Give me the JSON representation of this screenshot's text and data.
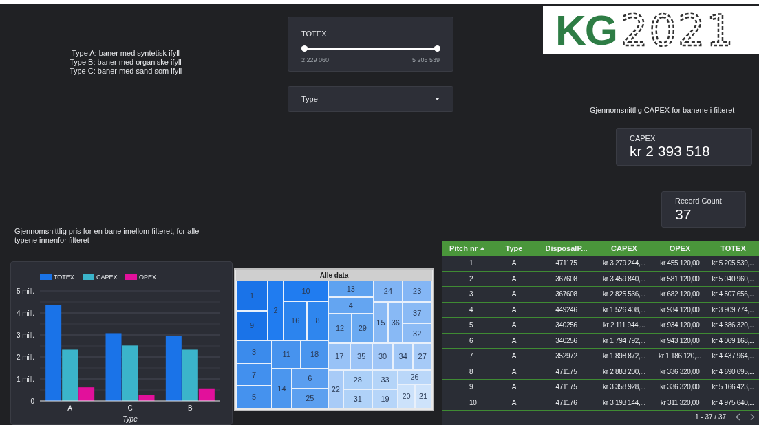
{
  "type_legend": [
    "Type A: baner med syntetisk ifyll",
    "Type B: baner med organiske ifyll",
    "Type C: baner med sand som ifyll"
  ],
  "totex_filter": {
    "label": "TOTEX",
    "min_thumb": {
      "level": 0
    },
    "max_thumb": {
      "level": 1
    },
    "min_value": "2 229 060",
    "max_value": "5 205 539"
  },
  "type_filter": {
    "label": "Type"
  },
  "logo": {
    "bold_text": "KG",
    "outline_text": "2021"
  },
  "capex_caption": "Gjennomsnittlig CAPEX for banene i filteret",
  "capex_scorecard": {
    "label": "CAPEX",
    "value": "kr 2 393 518"
  },
  "record_count": {
    "label": "Record Count",
    "value": "37"
  },
  "bar_chart_caption": "Gjennomsnittlig pris for en bane imellom filteret, for alle typene innenfor filteret",
  "bar_chart": {
    "chart_data": {
      "type": "bar",
      "xlabel": "Type",
      "categories": [
        "A",
        "C",
        "B"
      ],
      "series": [
        {
          "name": "TOTEX",
          "color": "#1a73e8",
          "values": [
            4.37,
            3.08,
            2.96
          ]
        },
        {
          "name": "CAPEX",
          "color": "#3bb4ca",
          "values": [
            2.33,
            2.52,
            2.33
          ]
        },
        {
          "name": "OPEX",
          "color": "#e2109b",
          "values": [
            0.62,
            0.27,
            0.57
          ]
        }
      ],
      "ylim": [
        0,
        5
      ],
      "grid": true,
      "legend": "top",
      "yticks": [
        {
          "value": 0,
          "label": "0"
        },
        {
          "value": 1,
          "label": "1 mill."
        },
        {
          "value": 2,
          "label": "2 mill."
        },
        {
          "value": 3,
          "label": "3 mill."
        },
        {
          "value": 4,
          "label": "4 mill."
        },
        {
          "value": 5,
          "label": "5 mill."
        }
      ]
    }
  },
  "treemap": {
    "title": "Alle data",
    "cells": [
      {
        "label": "1",
        "color": "#1a73e8"
      },
      {
        "label": "9",
        "color": "#1a73e8"
      },
      {
        "label": "2",
        "color": "#207cf0"
      },
      {
        "label": "10",
        "color": "#207cf0"
      },
      {
        "label": "16",
        "color": "#2c84ee"
      },
      {
        "label": "8",
        "color": "#2f86ee"
      },
      {
        "label": "13",
        "color": "#5ea2f0"
      },
      {
        "label": "4",
        "color": "#64a5f1"
      },
      {
        "label": "12",
        "color": "#68a8f1"
      },
      {
        "label": "29",
        "color": "#6aaaf2"
      },
      {
        "label": "24",
        "color": "#80b4f4"
      },
      {
        "label": "23",
        "color": "#84b6f5"
      },
      {
        "label": "15",
        "color": "#88b9f5"
      },
      {
        "label": "36",
        "color": "#88b9f5"
      },
      {
        "label": "37",
        "color": "#8abaf5"
      },
      {
        "label": "32",
        "color": "#8cbbf5"
      },
      {
        "label": "3",
        "color": "#3b8bec"
      },
      {
        "label": "7",
        "color": "#4290ee"
      },
      {
        "label": "5",
        "color": "#4592ee"
      },
      {
        "label": "11",
        "color": "#4793ee"
      },
      {
        "label": "18",
        "color": "#4a95ee"
      },
      {
        "label": "14",
        "color": "#4b96ee"
      },
      {
        "label": "6",
        "color": "#5a9ef0"
      },
      {
        "label": "25",
        "color": "#5ca0f0"
      },
      {
        "label": "17",
        "color": "#98c2f6"
      },
      {
        "label": "35",
        "color": "#9cc4f7"
      },
      {
        "label": "30",
        "color": "#a0c6f7"
      },
      {
        "label": "34",
        "color": "#a2c8f7"
      },
      {
        "label": "27",
        "color": "#a6caf7"
      },
      {
        "label": "22",
        "color": "#a8cbf7"
      },
      {
        "label": "28",
        "color": "#acd0f8"
      },
      {
        "label": "31",
        "color": "#b0d2f8"
      },
      {
        "label": "33",
        "color": "#b4d4f8"
      },
      {
        "label": "19",
        "color": "#b6d5f9"
      },
      {
        "label": "26",
        "color": "#bad7f9"
      },
      {
        "label": "20",
        "color": "#cce2fb"
      },
      {
        "label": "21",
        "color": "#cee3fb"
      }
    ]
  },
  "table": {
    "columns": [
      {
        "label": "Pitch nr",
        "sorted_ascending": true
      },
      {
        "label": "Type",
        "sorted_ascending": false
      },
      {
        "label": "DisposalP...",
        "sorted_ascending": false
      },
      {
        "label": "CAPEX",
        "sorted_ascending": false
      },
      {
        "label": "OPEX",
        "sorted_ascending": false
      },
      {
        "label": "TOTEX",
        "sorted_ascending": false
      }
    ],
    "rows": [
      [
        "1",
        "A",
        "471175",
        "kr 3 279 244,...",
        "kr 455 120,00",
        "kr 5 205 539,..."
      ],
      [
        "2",
        "A",
        "367608",
        "kr 3 459 840,...",
        "kr 581 120,00",
        "kr 5 040 960,..."
      ],
      [
        "3",
        "A",
        "367608",
        "kr 2 825 536,...",
        "kr 682 120,00",
        "kr 4 507 656,..."
      ],
      [
        "4",
        "A",
        "449246",
        "kr 1 526 408,...",
        "kr 934 120,00",
        "kr 3 909 774,..."
      ],
      [
        "5",
        "A",
        "340256",
        "kr 2 111 944,...",
        "kr 934 120,00",
        "kr 4 386 320,..."
      ],
      [
        "6",
        "A",
        "340256",
        "kr 1 794 792,...",
        "kr 943 120,00",
        "kr 4 069 168,..."
      ],
      [
        "7",
        "A",
        "352972",
        "kr 1 898 872,...",
        "kr 1 186 120,...",
        "kr 4 437 964,..."
      ],
      [
        "8",
        "A",
        "471175",
        "kr 2 883 200,...",
        "kr 336 320,00",
        "kr 4 690 695,..."
      ],
      [
        "9",
        "A",
        "471175",
        "kr 3 358 928,...",
        "kr 336 320,00",
        "kr 5 166 423,..."
      ],
      [
        "10",
        "A",
        "471176",
        "kr 3 193 144,...",
        "kr 311 320,00",
        "kr 4 975 640,..."
      ]
    ],
    "pager": "1 - 37 / 37"
  }
}
